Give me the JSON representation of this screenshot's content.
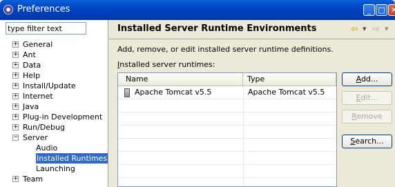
{
  "window": {
    "title": "Preferences",
    "min_glyph": "_",
    "max_glyph": "□",
    "close_glyph": "✕"
  },
  "filter": {
    "value": "type filter text"
  },
  "tree": {
    "items": [
      {
        "label": "General",
        "expander": "+",
        "level": 0
      },
      {
        "label": "Ant",
        "expander": "+",
        "level": 0
      },
      {
        "label": "Data",
        "expander": "+",
        "level": 0
      },
      {
        "label": "Help",
        "expander": "+",
        "level": 0
      },
      {
        "label": "Install/Update",
        "expander": "+",
        "level": 0
      },
      {
        "label": "Internet",
        "expander": "+",
        "level": 0
      },
      {
        "label": "Java",
        "expander": "+",
        "level": 0
      },
      {
        "label": "Plug-in Development",
        "expander": "+",
        "level": 0
      },
      {
        "label": "Run/Debug",
        "expander": "+",
        "level": 0
      },
      {
        "label": "Server",
        "expander": "−",
        "level": 0
      },
      {
        "label": "Audio",
        "expander": "",
        "level": 1
      },
      {
        "label": "Installed Runtimes",
        "expander": "",
        "level": 1,
        "selected": true
      },
      {
        "label": "Launching",
        "expander": "",
        "level": 1
      },
      {
        "label": "Team",
        "expander": "+",
        "level": 0
      }
    ]
  },
  "page": {
    "title": "Installed Server Runtime Environments",
    "description": "Add, remove, or edit installed server runtime definitions.",
    "table_label_mnemonic": "I",
    "table_label_rest": "nstalled server runtimes:",
    "nav_back_glyph": "⇦",
    "nav_forward_glyph": "⇨",
    "dropdown_glyph": "▼"
  },
  "table": {
    "columns": [
      "Name",
      "Type"
    ],
    "rows": [
      {
        "name": "Apache Tomcat v5.5",
        "type": "Apache Tomcat v5.5"
      }
    ]
  },
  "buttons": {
    "add": {
      "mnemonic": "A",
      "rest": "dd..."
    },
    "edit": {
      "mnemonic": "E",
      "rest": "dit..."
    },
    "remove": {
      "mnemonic": "R",
      "rest": "emove"
    },
    "search": {
      "mnemonic": "S",
      "rest": "earch..."
    }
  },
  "colors": {
    "titlebar": "#0040bf",
    "selection": "#316ac5",
    "panel": "#ece9d8"
  }
}
